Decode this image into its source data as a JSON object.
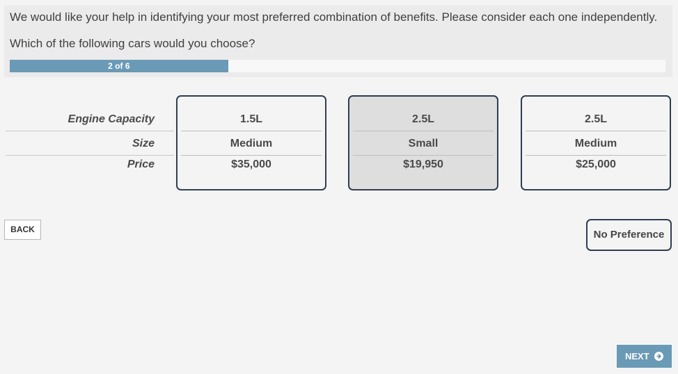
{
  "survey": {
    "intro_text": "We would like your help in identifying your most preferred combination of benefits. Please consider each one independently.",
    "question_text": "Which of the following cars would you choose?",
    "progress": {
      "label": "2 of 6",
      "fraction": 0.333
    }
  },
  "attributes": [
    "Engine Capacity",
    "Size",
    "Price"
  ],
  "concepts": [
    {
      "values": [
        "1.5L",
        "Medium",
        "$35,000"
      ],
      "selected": false
    },
    {
      "values": [
        "2.5L",
        "Small",
        "$19,950"
      ],
      "selected": true
    },
    {
      "values": [
        "2.5L",
        "Medium",
        "$25,000"
      ],
      "selected": false
    }
  ],
  "buttons": {
    "back_label": "BACK",
    "no_preference_label": "No Preference",
    "next_label": "NEXT"
  },
  "colors": {
    "accent": "#6a9ab5",
    "card_border": "#2f3e52",
    "selected_bg": "#dedede"
  },
  "icons": {
    "next": "arrow-circle-right-icon"
  }
}
